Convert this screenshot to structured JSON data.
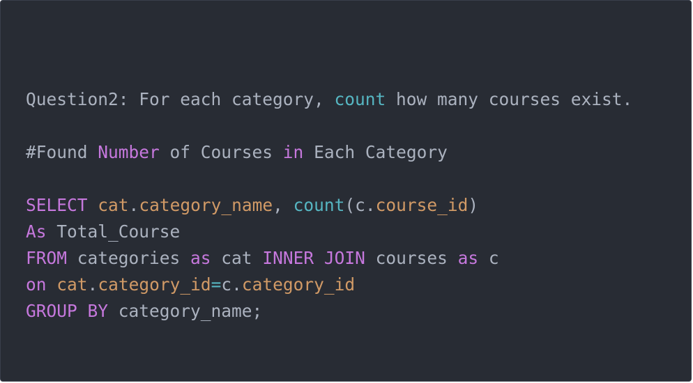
{
  "colors": {
    "background": "#282c34",
    "plain_text": "#abb2bf",
    "keyword": "#c678dd",
    "function": "#56b6c2",
    "identifier": "#d19a66"
  },
  "code": {
    "question": {
      "prefix": "Question2: For each category, ",
      "count_word": "count",
      "suffix": " how many courses exist."
    },
    "comment": {
      "part1": "#Found ",
      "number_word": "Number",
      "part2": " of Courses ",
      "in_word": "in",
      "part3": " Each Category"
    },
    "select_line": {
      "select_kw": "SELECT",
      "cat_alias": "cat",
      "dot1": ".",
      "category_name": "category_name",
      "comma": ", ",
      "count_fn": "count",
      "open_paren": "(",
      "c_alias": "c",
      "dot2": ".",
      "course_id": "course_id",
      "close_paren": ")"
    },
    "as_line": {
      "as_kw": "As",
      "total_course": " Total_Course"
    },
    "from_line": {
      "from_kw": "FROM",
      "categories": " categories ",
      "as_kw1": "as",
      "cat": " cat ",
      "inner_join_kw": "INNER JOIN",
      "courses": " courses ",
      "as_kw2": "as",
      "c": " c"
    },
    "on_line": {
      "on_kw": "on",
      "cat_alias": "cat",
      "dot1": ".",
      "category_id1": "category_id",
      "equals": "=",
      "c_alias": "c",
      "dot2": ".",
      "category_id2": "category_id"
    },
    "group_line": {
      "group_kw": "GROUP BY",
      "rest": " category_name;"
    }
  }
}
